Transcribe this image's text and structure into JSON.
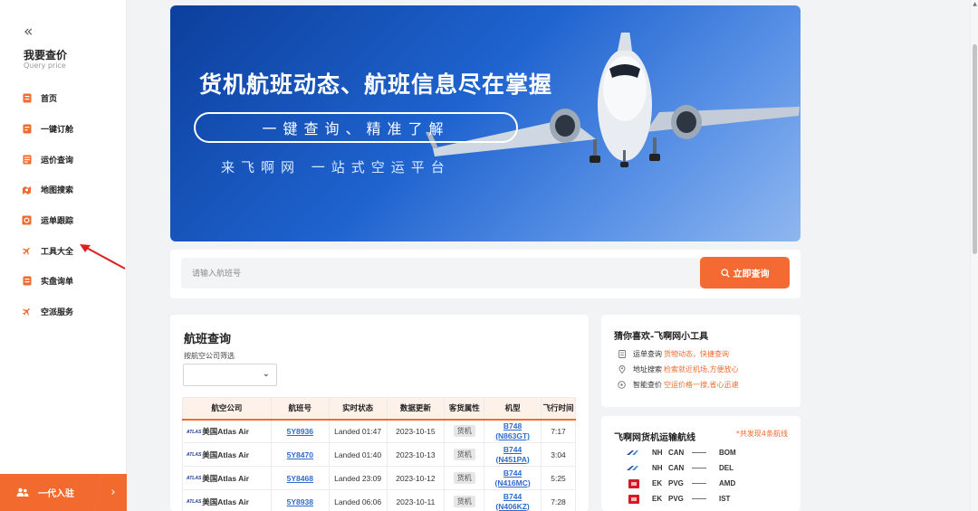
{
  "sidebar": {
    "collapse_glyph": "«",
    "title": "我要查价",
    "subtitle": "Query price",
    "items": [
      {
        "label": "首页",
        "icon": "home-icon"
      },
      {
        "label": "一键订舱",
        "icon": "booking-icon"
      },
      {
        "label": "运价查询",
        "icon": "price-query-icon"
      },
      {
        "label": "地图搜索",
        "icon": "map-search-icon"
      },
      {
        "label": "运单跟踪",
        "icon": "waybill-track-icon"
      },
      {
        "label": "工具大全",
        "icon": "plane-icon"
      },
      {
        "label": "实盘询单",
        "icon": "inquiry-icon"
      },
      {
        "label": "空派服务",
        "icon": "plane-service-icon"
      }
    ],
    "join_label": "一代入驻",
    "join_arrow": "›"
  },
  "banner": {
    "title": "货机航班动态、航班信息尽在掌握",
    "pill": "一键查询、精准了解",
    "subtitle": "来飞啊网 一站式空运平台"
  },
  "search": {
    "placeholder": "请输入航班号",
    "button_label": "立即查询"
  },
  "flight_query": {
    "title": "航班查询",
    "filter_label": "按航空公司筛选",
    "select_chevron": "⌄",
    "columns": [
      "航空公司",
      "航班号",
      "实时状态",
      "数据更新",
      "客货属性",
      "机型",
      "飞行时间"
    ],
    "rows": [
      {
        "logo": "ATLAS",
        "airline": "美国Atlas Air",
        "flight": "5Y8936",
        "status": "Landed 01:47",
        "updated": "2023-10-15",
        "type": "货机",
        "aircraft": "B748 (N863GT)",
        "duration": "7:17"
      },
      {
        "logo": "ATLAS",
        "airline": "美国Atlas Air",
        "flight": "5Y8470",
        "status": "Landed 01:40",
        "updated": "2023-10-13",
        "type": "货机",
        "aircraft": "B744 (N451PA)",
        "duration": "3:04"
      },
      {
        "logo": "ATLAS",
        "airline": "美国Atlas Air",
        "flight": "5Y8468",
        "status": "Landed 23:09",
        "updated": "2023-10-12",
        "type": "货机",
        "aircraft": "B744 (N416MC)",
        "duration": "5:25"
      },
      {
        "logo": "ATLAS",
        "airline": "美国Atlas Air",
        "flight": "5Y8938",
        "status": "Landed 06:06",
        "updated": "2023-10-11",
        "type": "货机",
        "aircraft": "B744 (N406KZ)",
        "duration": "7:28"
      }
    ]
  },
  "tools": {
    "title": "猜你喜欢-飞啊网小工具",
    "items": [
      {
        "name": "运单查询",
        "desc": "货物动态，快捷查询",
        "icon": "document-icon"
      },
      {
        "name": "地址搜索",
        "desc": "检索就近机场,方便放心",
        "icon": "location-icon"
      },
      {
        "name": "智能查价",
        "desc": "空运价格一搜,省心迅速",
        "icon": "smart-price-icon"
      }
    ]
  },
  "routes": {
    "title": "飞啊网货机运输航线",
    "count": "*共发现4条航线",
    "items": [
      {
        "airline": "NH",
        "from": "CAN",
        "dash": "——",
        "to": "BOM",
        "logo": "ana-logo-icon"
      },
      {
        "airline": "NH",
        "from": "CAN",
        "dash": "——",
        "to": "DEL",
        "logo": "ana-logo-icon"
      },
      {
        "airline": "EK",
        "from": "PVG",
        "dash": "——",
        "to": "AMD",
        "logo": "emirates-logo-icon"
      },
      {
        "airline": "EK",
        "from": "PVG",
        "dash": "——",
        "to": "IST",
        "logo": "emirates-logo-icon"
      }
    ]
  },
  "colors": {
    "accent": "#f26a2e",
    "link": "#2f6bcb",
    "banner_blue": "#1f63cf"
  }
}
